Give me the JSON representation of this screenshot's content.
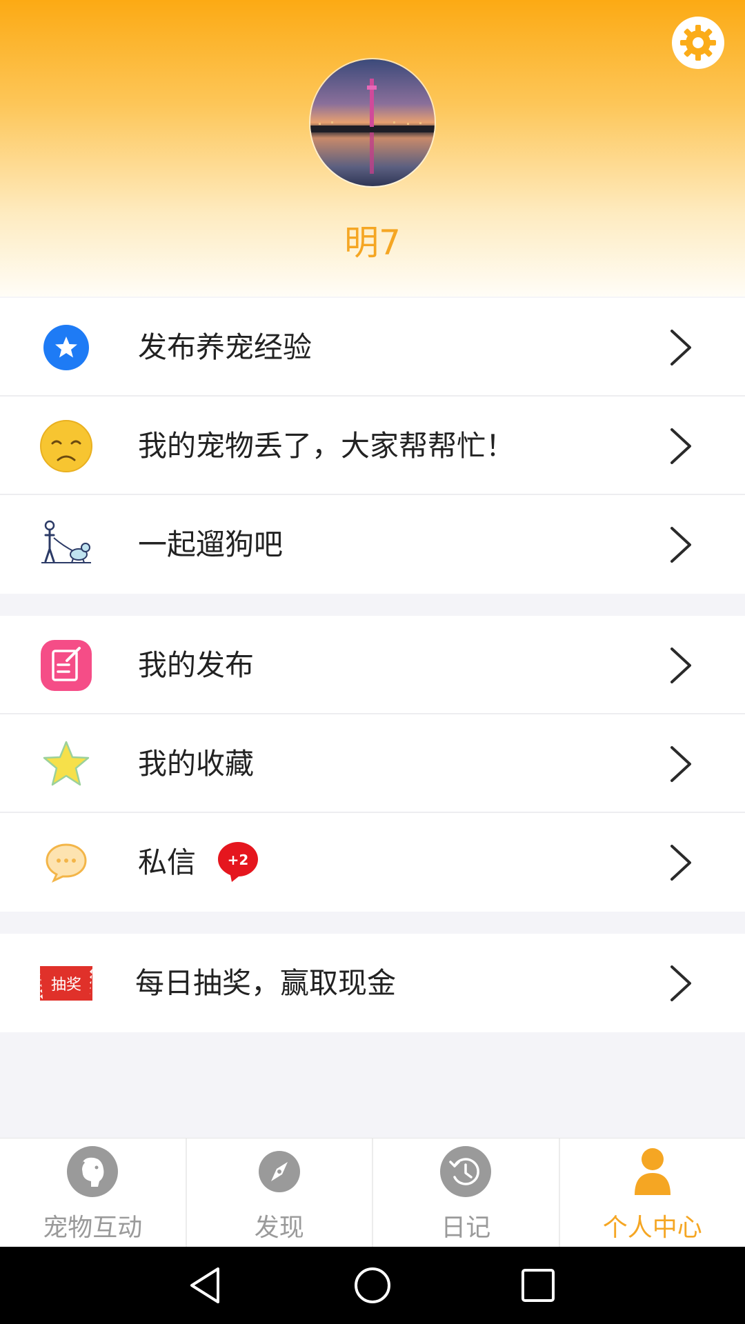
{
  "profile": {
    "username": "明7"
  },
  "menu_groups": [
    {
      "items": [
        {
          "label": "发布养宠经验",
          "icon": "star-circle-icon"
        },
        {
          "label": "我的宠物丢了，大家帮帮忙！",
          "icon": "sad-face-icon"
        },
        {
          "label": "一起遛狗吧",
          "icon": "walking-dog-icon"
        }
      ]
    },
    {
      "items": [
        {
          "label": "我的发布",
          "icon": "edit-note-icon"
        },
        {
          "label": "我的收藏",
          "icon": "star-icon"
        },
        {
          "label": "私信",
          "icon": "chat-bubble-icon",
          "badge": "+2"
        }
      ]
    },
    {
      "items": [
        {
          "label": "每日抽奖，赢取现金",
          "icon": "lottery-ticket-icon",
          "icon_text": "抽奖"
        }
      ]
    }
  ],
  "tabs": [
    {
      "label": "宠物互动",
      "icon": "dog-icon",
      "active": false
    },
    {
      "label": "发现",
      "icon": "compass-icon",
      "active": false
    },
    {
      "label": "日记",
      "icon": "history-clock-icon",
      "active": false
    },
    {
      "label": "个人中心",
      "icon": "person-icon",
      "active": true
    }
  ],
  "colors": {
    "accent": "#f5a623",
    "header_top": "#fcaa14",
    "badge": "#e5161e",
    "inactive_tab": "#9a9a9a"
  }
}
